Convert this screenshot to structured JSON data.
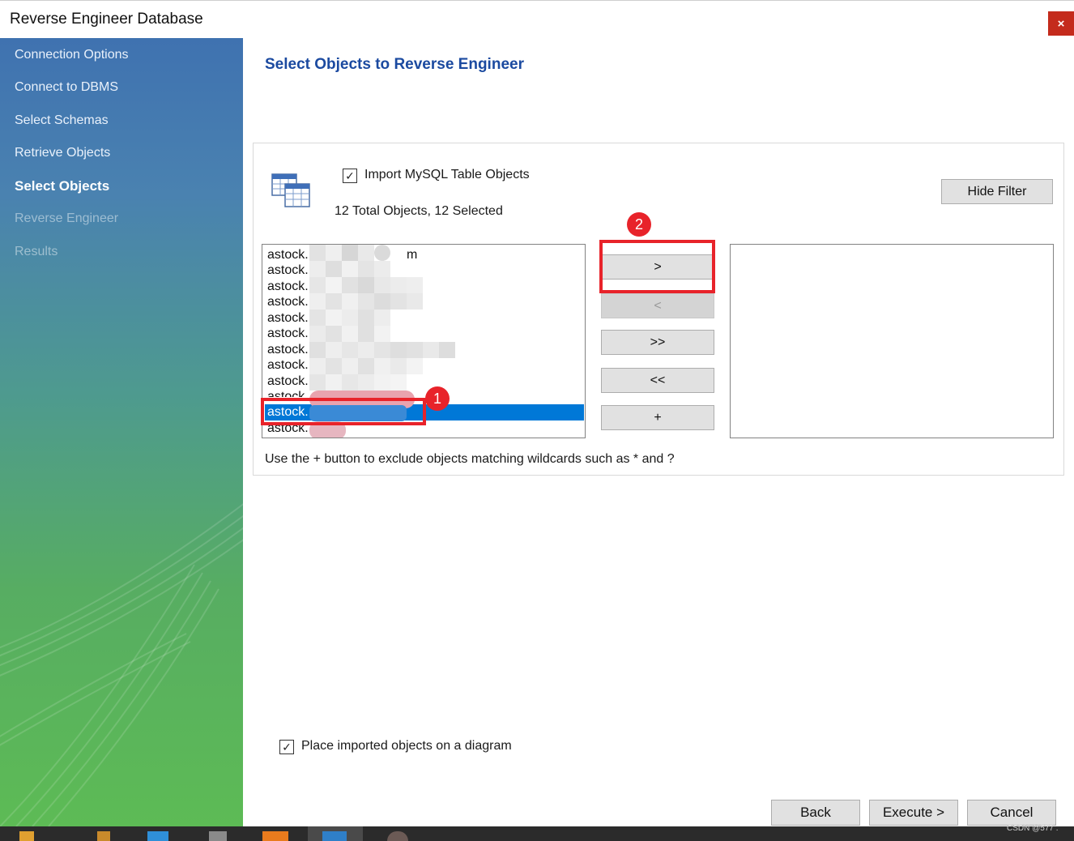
{
  "window": {
    "title": "Reverse Engineer Database",
    "close_label": "×"
  },
  "sidebar": {
    "steps": [
      {
        "label": "Connection Options",
        "state": "done"
      },
      {
        "label": "Connect to DBMS",
        "state": "done"
      },
      {
        "label": "Select Schemas",
        "state": "done"
      },
      {
        "label": "Retrieve Objects",
        "state": "done"
      },
      {
        "label": "Select Objects",
        "state": "active"
      },
      {
        "label": "Reverse Engineer",
        "state": "pending"
      },
      {
        "label": "Results",
        "state": "pending"
      }
    ]
  },
  "main": {
    "heading": "Select Objects to Reverse Engineer",
    "import_checkbox": {
      "label": "Import MySQL Table Objects",
      "checked": true
    },
    "summary": "12 Total Objects, 12 Selected",
    "hide_filter_label": "Hide Filter",
    "available_list": [
      {
        "text": "astock.",
        "tail": "m"
      },
      {
        "text": "astock."
      },
      {
        "text": "astock."
      },
      {
        "text": "astock."
      },
      {
        "text": "astock."
      },
      {
        "text": "astock."
      },
      {
        "text": "astock."
      },
      {
        "text": "astock."
      },
      {
        "text": "astock."
      },
      {
        "text": "astock."
      },
      {
        "text": "astock.",
        "selected": true
      },
      {
        "text": "astock."
      }
    ],
    "transfer_buttons": {
      "add": ">",
      "remove": "<",
      "add_all": ">>",
      "remove_all": "<<",
      "exclude": "+"
    },
    "hint": "Use the + button to exclude objects matching wildcards such as * and ?",
    "place_on_diagram": {
      "label": "Place imported objects on a diagram",
      "checked": true
    }
  },
  "annotations": {
    "badge_1": "1",
    "badge_2": "2",
    "color": "#e8232a"
  },
  "footer": {
    "back_label": "Back",
    "execute_label": "Execute >",
    "cancel_label": "Cancel"
  },
  "watermark": "CSDN @577 ."
}
